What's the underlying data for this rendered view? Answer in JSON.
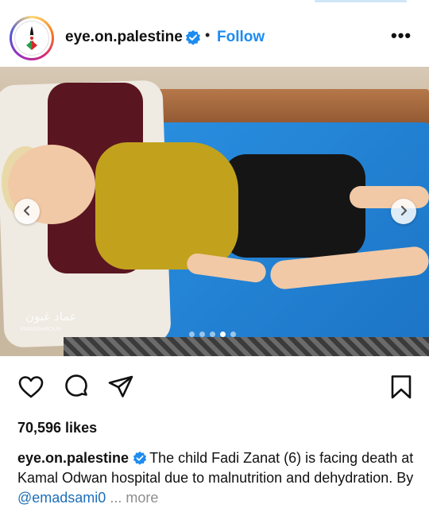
{
  "post": {
    "username": "eye.on.palestine",
    "separator": "•",
    "follow_label": "Follow",
    "more_menu": "•••",
    "verified": true,
    "accent_color": "#1d8cf0"
  },
  "media": {
    "watermark": "عماد غبون",
    "watermark_sub": "EMADGHBOUN",
    "carousel": {
      "total": 5,
      "active": 4
    },
    "prev_icon": "chevron-left-icon",
    "next_icon": "chevron-right-icon"
  },
  "actions": {
    "like_icon": "heart-icon",
    "comment_icon": "comment-icon",
    "share_icon": "send-icon",
    "save_icon": "bookmark-icon"
  },
  "likes": "70,596 likes",
  "caption": {
    "username": "eye.on.palestine",
    "text": "The child Fadi Zanat (6) is facing death at Kamal Odwan hospital due to malnutrition and dehydration. By ",
    "mention": "@emadsami0",
    "ellipsis": " ... ",
    "more_label": "more"
  }
}
